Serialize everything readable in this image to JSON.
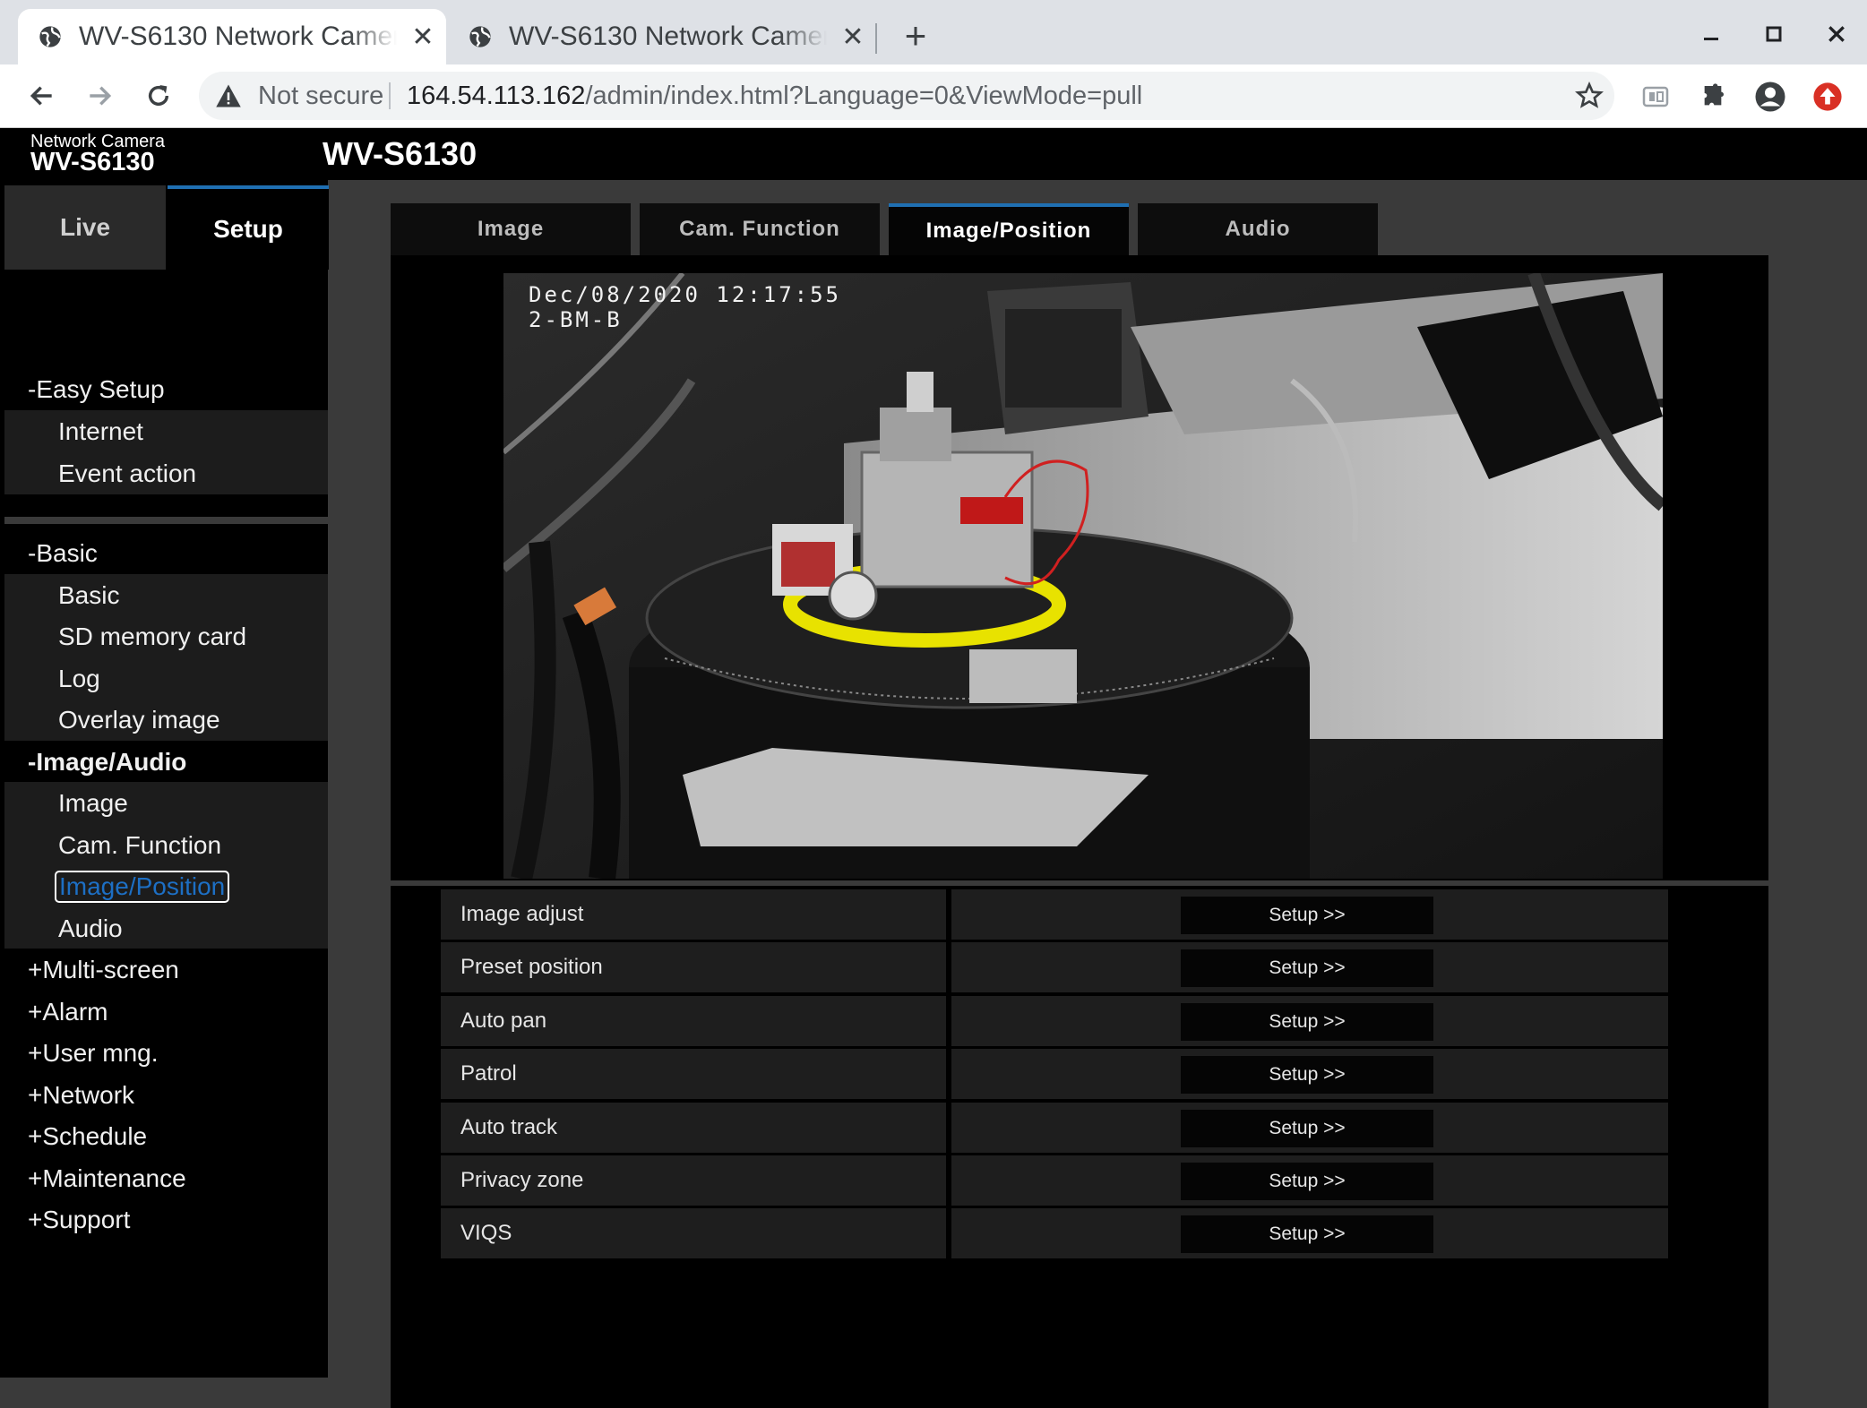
{
  "browser": {
    "tabs": [
      {
        "title": "WV-S6130 Network Camera",
        "active": true
      },
      {
        "title": "WV-S6130 Network Camera",
        "active": false
      }
    ],
    "address": {
      "security_label": "Not secure",
      "host": "164.54.113.162",
      "path": "/admin/index.html?Language=0&ViewMode=pull"
    }
  },
  "camera": {
    "brand_small": "Network Camera",
    "brand_model": "WV-S6130",
    "title": "WV-S6130"
  },
  "mode_tabs": {
    "live": "Live",
    "setup": "Setup"
  },
  "menu": {
    "easy_setup": "-Easy Setup",
    "internet": "Internet",
    "event_action": "Event action",
    "basic_group": "-Basic",
    "basic": "Basic",
    "sd_card": "SD memory card",
    "log": "Log",
    "overlay_image": "Overlay image",
    "image_audio": "-Image/Audio",
    "image": "Image",
    "cam_function": "Cam. Function",
    "image_position": "Image/Position",
    "audio": "Audio",
    "multi_screen": "+Multi-screen",
    "alarm": "+Alarm",
    "user_mng": "+User mng.",
    "network": "+Network",
    "schedule": "+Schedule",
    "maintenance": "+Maintenance",
    "support": "+Support"
  },
  "content_tabs": [
    "Image",
    "Cam. Function",
    "Image/Position",
    "Audio"
  ],
  "active_content_tab": "Image/Position",
  "video": {
    "timestamp": "Dec/08/2020 12:17:55",
    "camera_label": "2-BM-B"
  },
  "settings": [
    {
      "label": "Image adjust",
      "button": "Setup >>"
    },
    {
      "label": "Preset position",
      "button": "Setup >>"
    },
    {
      "label": "Auto pan",
      "button": "Setup >>"
    },
    {
      "label": "Patrol",
      "button": "Setup >>"
    },
    {
      "label": "Auto track",
      "button": "Setup >>"
    },
    {
      "label": "Privacy zone",
      "button": "Setup >>"
    },
    {
      "label": "VIQS",
      "button": "Setup >>"
    }
  ],
  "colors": {
    "accent": "#1f6fb2",
    "selected_link": "#1d6fc4",
    "page_bg": "#3a3a3a"
  }
}
